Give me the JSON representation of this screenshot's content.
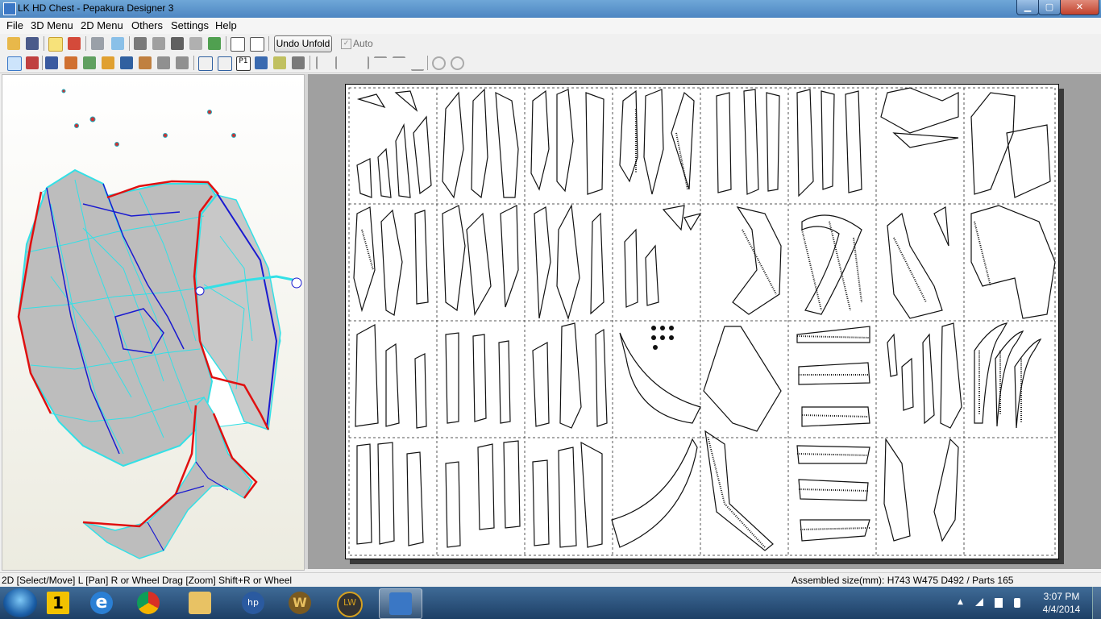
{
  "window": {
    "title": "LK HD Chest - Pepakura Designer 3"
  },
  "menu": [
    "File",
    "3D Menu",
    "2D Menu",
    "Others",
    "Settings",
    "Help"
  ],
  "toolbar": {
    "undo_label": "Undo Unfold",
    "auto_label": "Auto",
    "auto_checked": true
  },
  "status": {
    "left": "2D [Select/Move] L [Pan] R or Wheel Drag [Zoom] Shift+R or Wheel",
    "right": "Assembled size(mm): H743 W475 D492 / Parts 165"
  },
  "taskbar": {
    "apps": [
      "start-orb",
      "numbered-app",
      "internet-explorer",
      "chrome",
      "windows-explorer",
      "hp-app",
      "warcraft-app",
      "livewire-app",
      "pepakura-app"
    ],
    "active": "pepakura-app",
    "time": "3:07 PM",
    "date": "4/4/2014"
  },
  "colors": {
    "cyan": "#33e0e6",
    "blue": "#1a1ad0",
    "red": "#e01010",
    "gray": "#b8b8b8"
  },
  "sheet": {
    "columns": 8,
    "rows": 4
  }
}
